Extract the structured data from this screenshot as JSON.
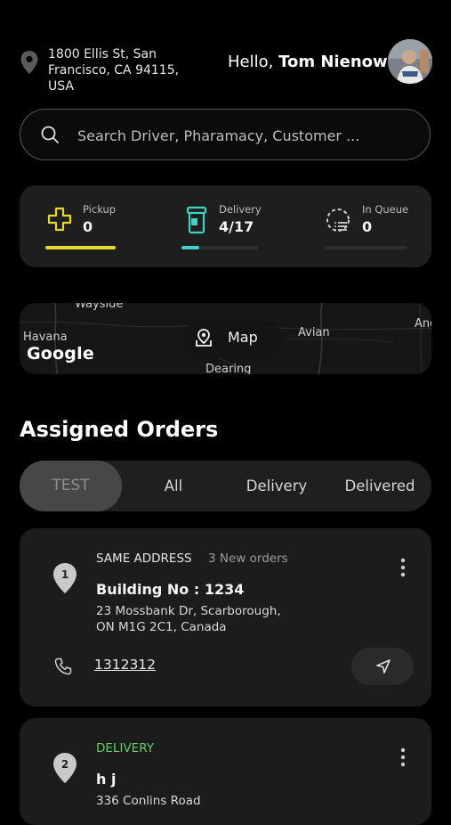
{
  "header": {
    "address_line1": "1800 Ellis St, San",
    "address_line2": "Francisco, CA 94115, USA",
    "greeting": "Hello,",
    "user_name": "Tom Nienow"
  },
  "search": {
    "placeholder": "Search Driver, Pharamacy, Customer ..."
  },
  "stats": [
    {
      "label": "Pickup",
      "value": "0",
      "icon": "medical-cross-icon",
      "color": "#e6d832",
      "progress": 1.0
    },
    {
      "label": "Delivery",
      "value": "4/17",
      "icon": "pill-bottle-icon",
      "color": "#3fd3c3",
      "progress": 0.235
    },
    {
      "label": "In Queue",
      "value": "0",
      "icon": "queue-list-icon",
      "color": "#cfcfcf",
      "progress": 0
    }
  ],
  "map": {
    "button_label": "Map",
    "logo": "Google",
    "places": [
      "Wayside",
      "Havana",
      "Avian",
      "Ang",
      "Dearing"
    ]
  },
  "section_title": "Assigned Orders",
  "tabs": [
    {
      "label": "TEST",
      "active": true
    },
    {
      "label": "All",
      "active": false
    },
    {
      "label": "Delivery",
      "active": false
    },
    {
      "label": "Delivered",
      "active": false
    }
  ],
  "orders": [
    {
      "number": "1",
      "type": "SAME ADDRESS",
      "count": "3 New orders",
      "title": "Building No : 1234",
      "address_line1": "23 Mossbank Dr, Scarborough,",
      "address_line2": "ON M1G 2C1, Canada",
      "phone": "1312312"
    },
    {
      "number": "2",
      "type": "DELIVERY",
      "type_color": "#69c866",
      "title": "h j",
      "address_line1": "336 Conlins Road"
    }
  ]
}
